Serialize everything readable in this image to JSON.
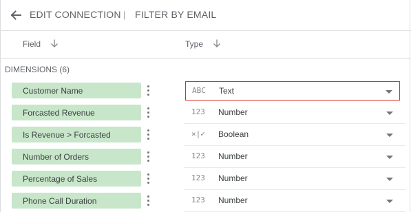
{
  "header": {
    "title": "EDIT CONNECTION",
    "separator": "|",
    "filter": "FILTER BY EMAIL"
  },
  "columns": {
    "field": "Field",
    "type": "Type"
  },
  "section": {
    "label": "DIMENSIONS (6)"
  },
  "rows": [
    {
      "field": "Customer Name",
      "type_icon": "ABC",
      "type": "Text"
    },
    {
      "field": "Forcasted Revenue",
      "type_icon": "123",
      "type": "Number"
    },
    {
      "field": "Is Revenue > Forcasted",
      "type_icon": "×|✓",
      "type": "Boolean"
    },
    {
      "field": "Number of Orders",
      "type_icon": "123",
      "type": "Number"
    },
    {
      "field": "Percentage of Sales",
      "type_icon": "123",
      "type": "Number"
    },
    {
      "field": "Phone Call Duration",
      "type_icon": "123",
      "type": "Number"
    }
  ],
  "colors": {
    "chip": "#c8e6c9",
    "selected_border": "#d93025"
  },
  "icons": {
    "back": "arrow-left-icon",
    "sort": "arrow-down-icon",
    "more": "kebab-menu-icon",
    "dropdown": "caret-down-icon"
  }
}
